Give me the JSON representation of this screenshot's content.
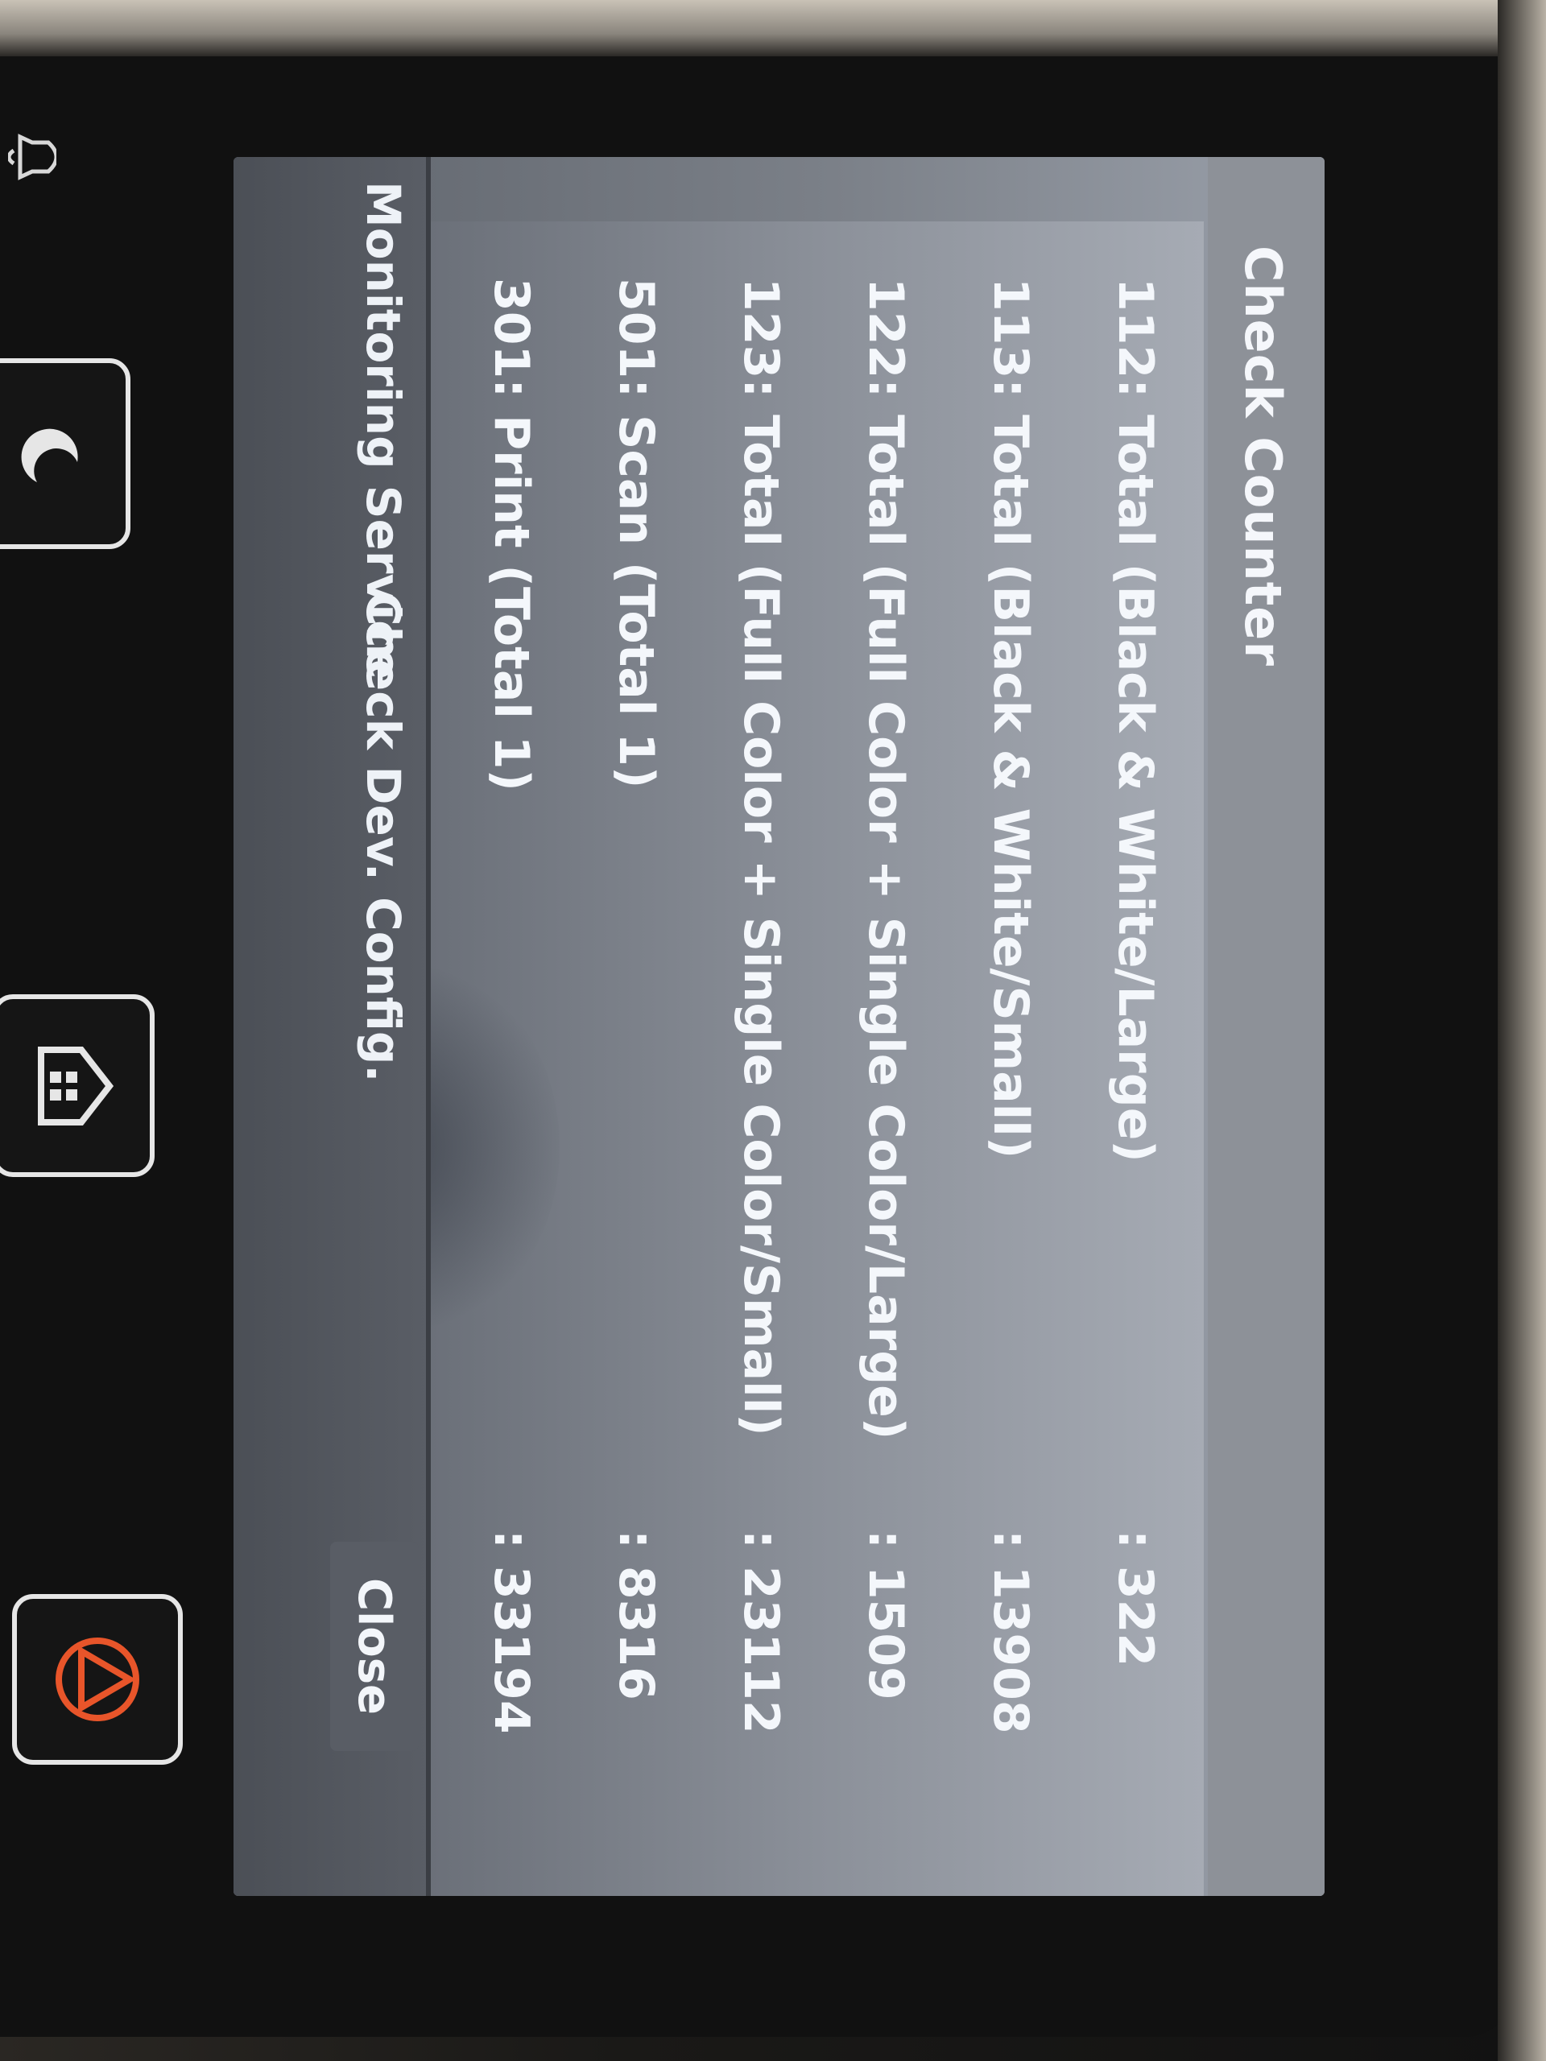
{
  "screen": {
    "title": "Check Counter",
    "counters": [
      {
        "label": "112: Total (Black & White/Large)",
        "value": ": 322"
      },
      {
        "label": "113: Total (Black & White/Small)",
        "value": ": 13908"
      },
      {
        "label": "122: Total (Full Color + Single Color/Large)",
        "value": ": 1509"
      },
      {
        "label": "123: Total (Full Color + Single Color/Small)",
        "value": ": 23112"
      },
      {
        "label": "501: Scan (Total 1)",
        "value": ": 8316"
      },
      {
        "label": "301: Print (Total 1)",
        "value": ": 33194"
      }
    ],
    "footer": {
      "monitoring_label": "Monitoring Service",
      "devconfig_label": "Check Dev. Config.",
      "close_label": "Close"
    }
  },
  "device_buttons": {
    "sleep_icon": "moon-icon",
    "home_icon": "home-icon",
    "stop_icon": "stop-icon",
    "notification_icon": "bell-icon",
    "stop_color": "#e8552a"
  }
}
